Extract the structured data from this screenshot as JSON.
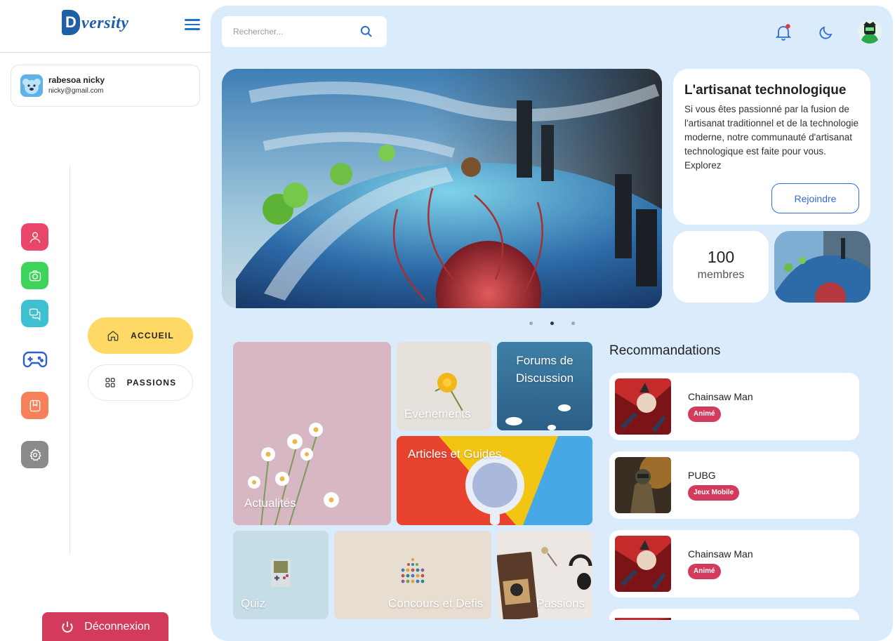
{
  "app": {
    "logo_text": "versity",
    "logo_letter": "D"
  },
  "user": {
    "name": "rabesoa nicky",
    "email": "nicky@gmail.com"
  },
  "sidebar": {
    "icons": [
      {
        "name": "user-icon",
        "color": "#e8476b"
      },
      {
        "name": "camera-icon",
        "color": "#3ed35a"
      },
      {
        "name": "chat-icon",
        "color": "#3ec0d0"
      },
      {
        "name": "gamepad-icon",
        "color": "#2f5fd0"
      },
      {
        "name": "bookmark-icon",
        "color": "#f5805a"
      },
      {
        "name": "gear-icon",
        "color": "#8a8a8a"
      }
    ],
    "nav": {
      "home_label": "ACCUEIL",
      "passions_label": "PASSIONS"
    },
    "logout_label": "Déconnexion"
  },
  "search": {
    "placeholder": "Rechercher..."
  },
  "feature": {
    "title": "L'artisanat technologique",
    "description": "Si vous êtes passionné par la fusion de l'artisanat traditionnel et de la technologie moderne, notre communauté d'artisanat technologique est faite pour vous. Explorez",
    "join_label": "Rejoindre",
    "members_count": "100",
    "members_label": "membres"
  },
  "carousel": {
    "total": 3,
    "active": 2
  },
  "categories": {
    "actualites": "Actualités",
    "evenements": "Evènements",
    "forums": "Forums de Discussion",
    "articles": "Articles et Guides",
    "quiz": "Quiz",
    "concours": "Concours et Défis",
    "passions": "Passions"
  },
  "recommendations": {
    "title": "Recommandations",
    "items": [
      {
        "name": "Chainsaw Man",
        "tag": "Animé"
      },
      {
        "name": "PUBG",
        "tag": "Jeux Mobile"
      },
      {
        "name": "Chainsaw Man",
        "tag": "Animé"
      }
    ]
  },
  "colors": {
    "accent": "#2f6dd1",
    "main_bg": "#daecfb",
    "active_nav": "#ffd966",
    "tag": "#d33b5c",
    "logout": "#d33b5c"
  }
}
